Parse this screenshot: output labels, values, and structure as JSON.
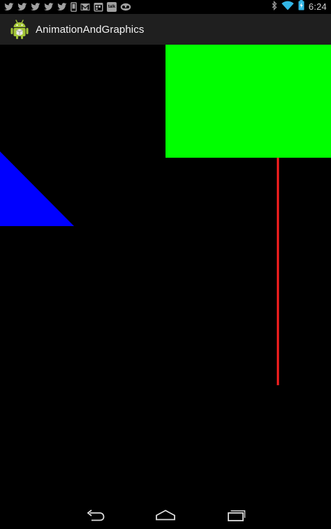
{
  "status_bar": {
    "notification_icons": [
      "twitter-icon",
      "twitter-icon",
      "twitter-icon",
      "twitter-icon",
      "twitter-icon",
      "phone-icon",
      "gmail-icon",
      "calendar-icon",
      "talk-icon",
      "voicemail-icon"
    ],
    "talk_icon_text": "talk",
    "system_icons": [
      "bluetooth-icon",
      "wifi-icon",
      "battery-icon"
    ],
    "time": "6:24"
  },
  "action_bar": {
    "app_icon": "android-robot-icon",
    "title": "AnimationAndGraphics"
  },
  "canvas": {
    "background_color": "#000000",
    "shapes": [
      {
        "name": "green-rectangle",
        "color": "#00ff00"
      },
      {
        "name": "blue-triangle",
        "color": "#0000ff"
      },
      {
        "name": "red-line",
        "color": "#ff2020"
      }
    ]
  },
  "nav_bar": {
    "buttons": [
      "back-icon",
      "home-icon",
      "recent-apps-icon"
    ]
  }
}
